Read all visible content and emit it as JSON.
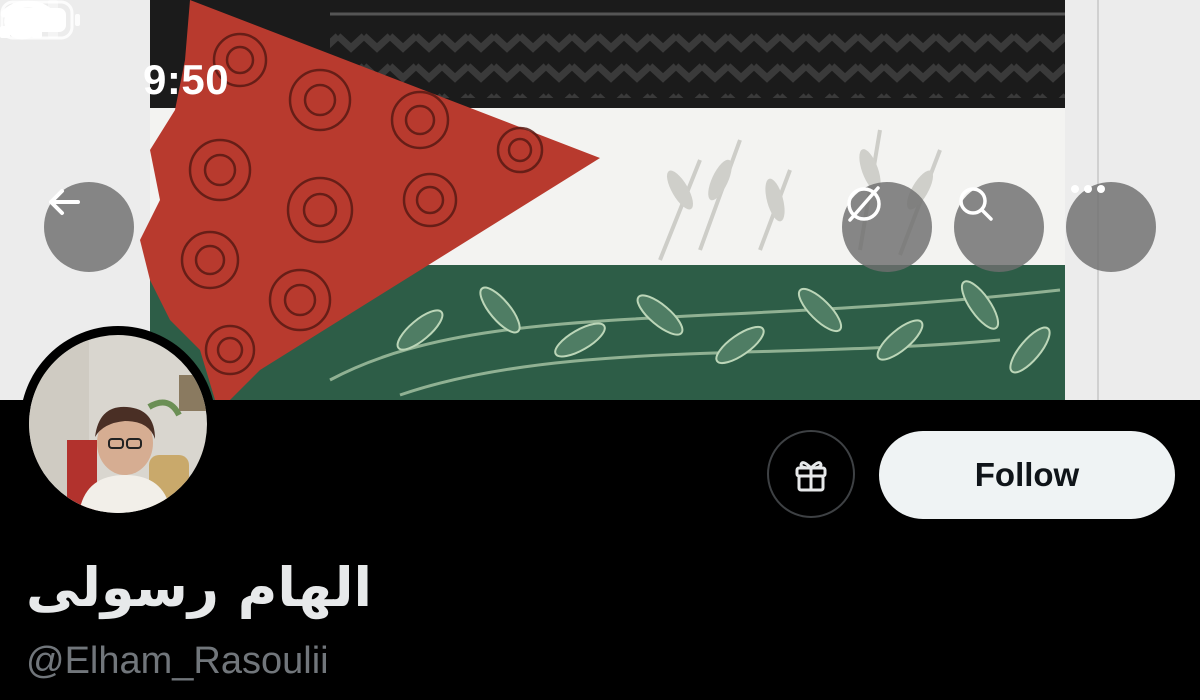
{
  "status_bar": {
    "time": "9:50"
  },
  "banner": {
    "icons": {
      "back": "arrow-left-icon",
      "translate": "globe-translate-icon",
      "search": "search-icon",
      "more": "more-horizontal-icon"
    }
  },
  "profile": {
    "display_name": "الهام رسولی",
    "handle": "@Elham_Rasoulii",
    "gift_icon": "gift-icon",
    "follow_label": "Follow"
  },
  "colors": {
    "background": "#000000",
    "flag_red": "#b83a2e",
    "flag_green": "#2d5d47",
    "flag_black": "#1a1a1a",
    "follow_bg": "#eff3f4",
    "handle_gray": "#71767b"
  }
}
